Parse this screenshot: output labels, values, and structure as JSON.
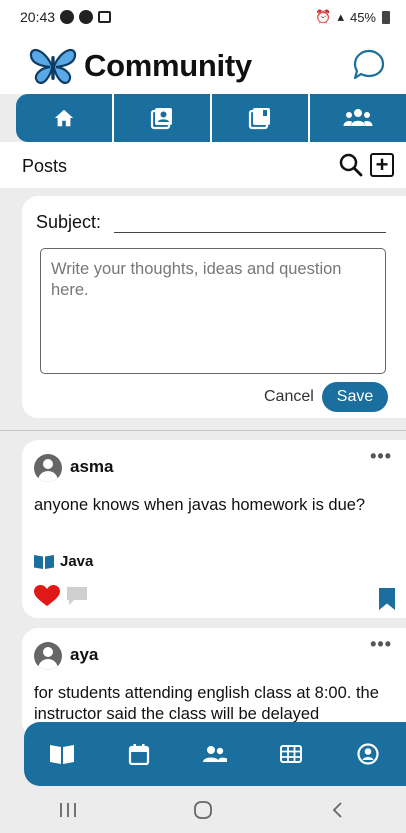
{
  "status_bar": {
    "time": "20:43",
    "battery": "45%"
  },
  "header": {
    "title": "Community"
  },
  "top_tabs": [
    {
      "icon": "home-icon"
    },
    {
      "icon": "contacts-book-icon"
    },
    {
      "icon": "photo-library-icon"
    },
    {
      "icon": "group-icon"
    }
  ],
  "posts_bar": {
    "title": "Posts"
  },
  "compose": {
    "subject_label": "Subject:",
    "message_placeholder": "Write your thoughts, ideas and question here.",
    "cancel_label": "Cancel",
    "save_label": "Save"
  },
  "posts": [
    {
      "author": "asma",
      "text": "anyone knows when javas homework is due?",
      "tag": "Java"
    },
    {
      "author": "aya",
      "text": "for students attending english class at 8:00. the instructor said the class will be delayed"
    }
  ],
  "colors": {
    "accent": "#1a6f9e",
    "heart": "#e01818"
  }
}
